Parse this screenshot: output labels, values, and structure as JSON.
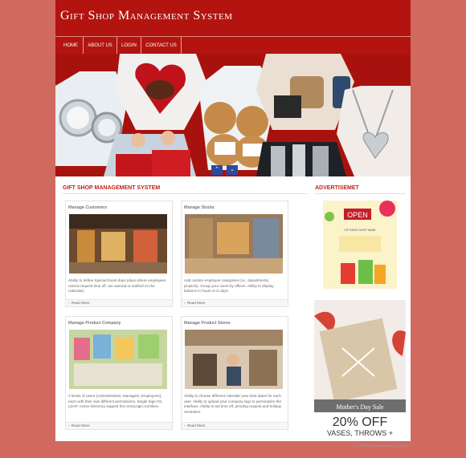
{
  "header": {
    "title": "Gift Shop Management System"
  },
  "nav": {
    "items": [
      "HOME",
      "ABOUT US",
      "LOGIN",
      "CONTACT US"
    ]
  },
  "banner": {
    "prev_icon": "chevron-left-icon",
    "next_icon": "chevron-down-icon"
  },
  "main": {
    "section_title": "GIFT SHOP MANAGEMENT SYSTEM",
    "cards": [
      {
        "title": "Manage Customers",
        "text": "Ability to define Special Event days (days where employees cannot request time off, are warned or notified on the calendar).",
        "more": "Read More"
      },
      {
        "title": "Manage Stocks",
        "text": "Add custom employee categories (i.e., departments, projects). Group your users by offices. Ability to display balance in hours or in days",
        "more": "Read More"
      },
      {
        "title": "Manage Product Company",
        "text": "3 levels of users (Administrators, Managers, Employees), each with their own different permissions. Single Sign-On, LDAP, Active Directory support thru OneLogin.com/kiev",
        "more": "Read More"
      },
      {
        "title": "Manage Product Stores",
        "text": "Ability to choose different calendar year start dates for each user. Ability to upload your company logo to personalize the interface. Ability to set time off, pending request and holiday reminders",
        "more": "Read More"
      }
    ]
  },
  "sidebar": {
    "title": "ADVERTISEMET",
    "ad1": {
      "line1": "OPEN",
      "line2": "GIFTNESS SHOP NAME"
    },
    "ad2": {
      "line1": "Mother's Day Sale",
      "line2": "20% OFF",
      "line3": "VASES, THROWS +"
    }
  },
  "footer": {
    "copyright": "© Gift Shop Management System"
  }
}
